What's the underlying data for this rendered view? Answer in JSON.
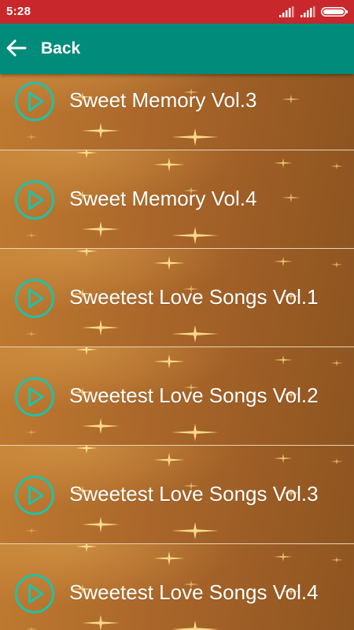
{
  "status_bar": {
    "time": "5:28",
    "background": "#c8282c"
  },
  "app_bar": {
    "title": "Back",
    "background": "#008b7a",
    "back_icon": "arrow-left-icon"
  },
  "list": {
    "item_icon": "play-circle-icon",
    "icon_color": "#1fc2a8",
    "items": [
      {
        "title": "Sweet Memory Vol.3"
      },
      {
        "title": "Sweet Memory Vol.4"
      },
      {
        "title": "Sweetest Love Songs Vol.1"
      },
      {
        "title": "Sweetest Love Songs Vol.2"
      },
      {
        "title": "Sweetest Love Songs Vol.3"
      },
      {
        "title": "Sweetest Love Songs Vol.4"
      }
    ]
  }
}
